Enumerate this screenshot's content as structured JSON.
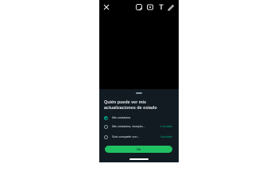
{
  "header": {
    "icons": [
      "close-icon",
      "sticker-icon",
      "gif-icon",
      "text-icon",
      "pencil-icon"
    ],
    "text_icon_glyph": "T"
  },
  "sheet": {
    "title": "Quién puede ver mis actualizaciones de estado",
    "options": [
      {
        "label": "Mis contactos",
        "count": "",
        "selected": true
      },
      {
        "label": "Mis contactos, excepto...",
        "count": "1 excluido",
        "selected": false
      },
      {
        "label": "Solo compartir con...",
        "count": "2 incluidos",
        "selected": false
      }
    ],
    "ok_label": "OK"
  },
  "colors": {
    "accent": "#00a884",
    "button": "#21c063",
    "sheet_bg": "#121b22",
    "screen_bg": "#000000"
  }
}
